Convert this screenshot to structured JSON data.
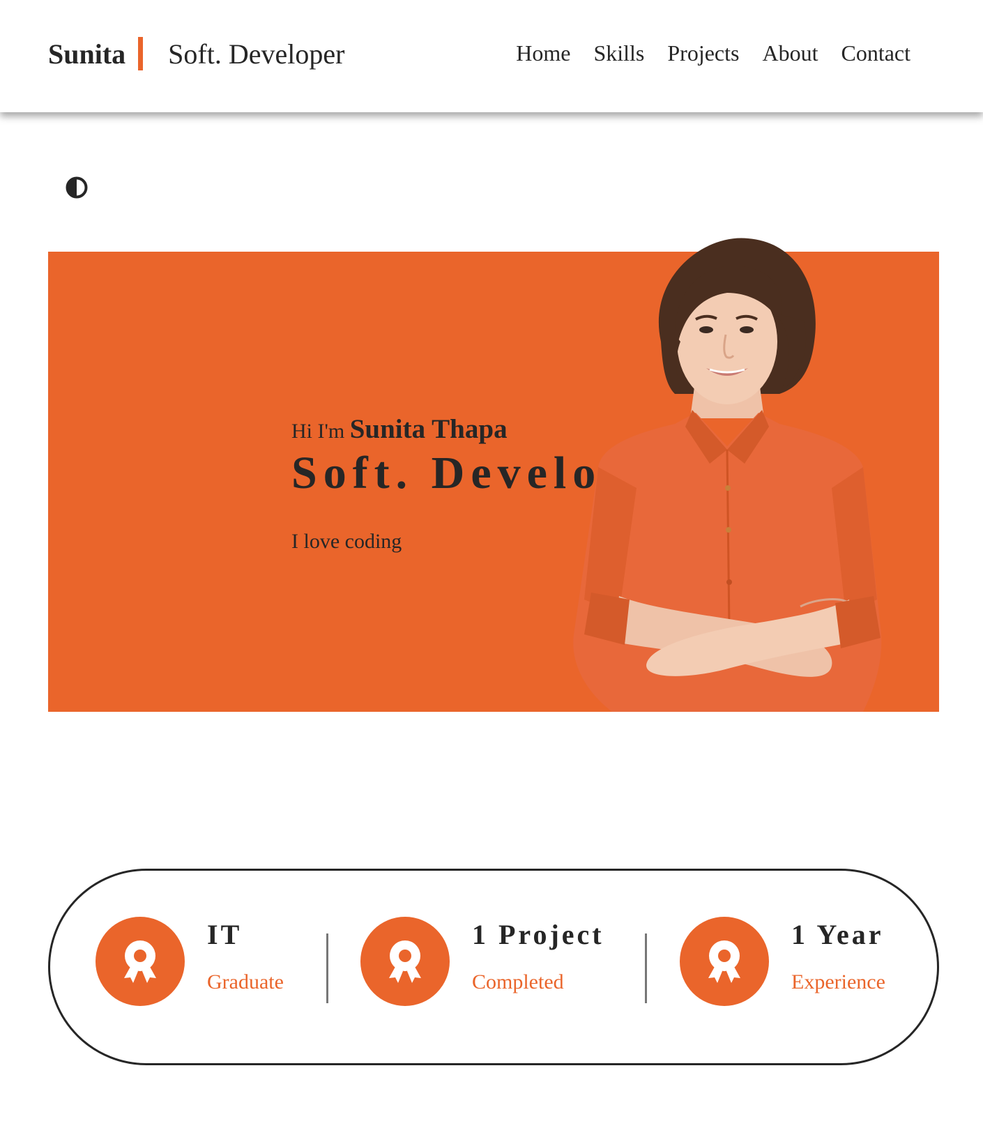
{
  "colors": {
    "accent": "#ea652b",
    "text": "#262626",
    "background": "#ffffff"
  },
  "header": {
    "brand_name": "Sunita",
    "brand_role": "Soft. Developer",
    "nav": [
      "Home",
      "Skills",
      "Projects",
      "About",
      "Contact"
    ]
  },
  "theme_toggle": {
    "icon": "contrast-icon"
  },
  "hero": {
    "greeting": "Hi I'm",
    "name": "Sunita Thapa",
    "role": "Soft. Develo",
    "tagline": "I love coding",
    "image": "woman-portrait"
  },
  "stats": [
    {
      "value": "IT",
      "label": "Graduate",
      "icon": "award-icon"
    },
    {
      "value": "1 Project",
      "label": "Completed",
      "icon": "award-icon"
    },
    {
      "value": "1 Year",
      "label": "Experience",
      "icon": "award-icon"
    }
  ]
}
